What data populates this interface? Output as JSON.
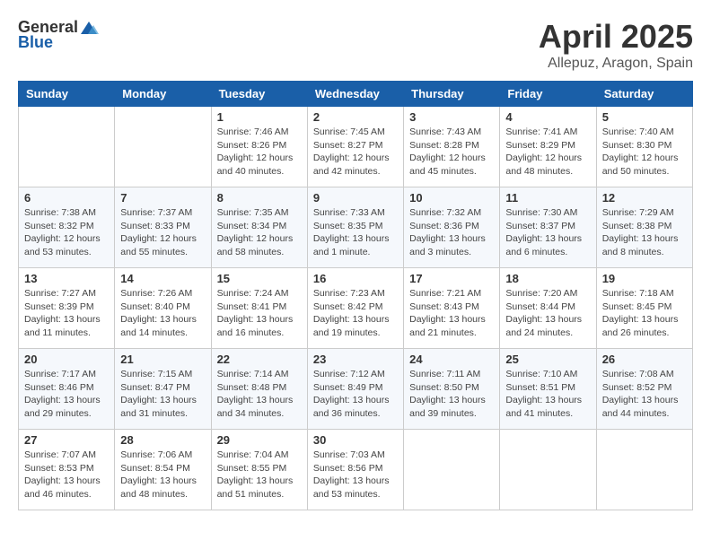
{
  "header": {
    "logo_general": "General",
    "logo_blue": "Blue",
    "month_title": "April 2025",
    "location": "Allepuz, Aragon, Spain"
  },
  "calendar": {
    "days_of_week": [
      "Sunday",
      "Monday",
      "Tuesday",
      "Wednesday",
      "Thursday",
      "Friday",
      "Saturday"
    ],
    "weeks": [
      [
        {
          "day": "",
          "detail": ""
        },
        {
          "day": "",
          "detail": ""
        },
        {
          "day": "1",
          "detail": "Sunrise: 7:46 AM\nSunset: 8:26 PM\nDaylight: 12 hours and 40 minutes."
        },
        {
          "day": "2",
          "detail": "Sunrise: 7:45 AM\nSunset: 8:27 PM\nDaylight: 12 hours and 42 minutes."
        },
        {
          "day": "3",
          "detail": "Sunrise: 7:43 AM\nSunset: 8:28 PM\nDaylight: 12 hours and 45 minutes."
        },
        {
          "day": "4",
          "detail": "Sunrise: 7:41 AM\nSunset: 8:29 PM\nDaylight: 12 hours and 48 minutes."
        },
        {
          "day": "5",
          "detail": "Sunrise: 7:40 AM\nSunset: 8:30 PM\nDaylight: 12 hours and 50 minutes."
        }
      ],
      [
        {
          "day": "6",
          "detail": "Sunrise: 7:38 AM\nSunset: 8:32 PM\nDaylight: 12 hours and 53 minutes."
        },
        {
          "day": "7",
          "detail": "Sunrise: 7:37 AM\nSunset: 8:33 PM\nDaylight: 12 hours and 55 minutes."
        },
        {
          "day": "8",
          "detail": "Sunrise: 7:35 AM\nSunset: 8:34 PM\nDaylight: 12 hours and 58 minutes."
        },
        {
          "day": "9",
          "detail": "Sunrise: 7:33 AM\nSunset: 8:35 PM\nDaylight: 13 hours and 1 minute."
        },
        {
          "day": "10",
          "detail": "Sunrise: 7:32 AM\nSunset: 8:36 PM\nDaylight: 13 hours and 3 minutes."
        },
        {
          "day": "11",
          "detail": "Sunrise: 7:30 AM\nSunset: 8:37 PM\nDaylight: 13 hours and 6 minutes."
        },
        {
          "day": "12",
          "detail": "Sunrise: 7:29 AM\nSunset: 8:38 PM\nDaylight: 13 hours and 8 minutes."
        }
      ],
      [
        {
          "day": "13",
          "detail": "Sunrise: 7:27 AM\nSunset: 8:39 PM\nDaylight: 13 hours and 11 minutes."
        },
        {
          "day": "14",
          "detail": "Sunrise: 7:26 AM\nSunset: 8:40 PM\nDaylight: 13 hours and 14 minutes."
        },
        {
          "day": "15",
          "detail": "Sunrise: 7:24 AM\nSunset: 8:41 PM\nDaylight: 13 hours and 16 minutes."
        },
        {
          "day": "16",
          "detail": "Sunrise: 7:23 AM\nSunset: 8:42 PM\nDaylight: 13 hours and 19 minutes."
        },
        {
          "day": "17",
          "detail": "Sunrise: 7:21 AM\nSunset: 8:43 PM\nDaylight: 13 hours and 21 minutes."
        },
        {
          "day": "18",
          "detail": "Sunrise: 7:20 AM\nSunset: 8:44 PM\nDaylight: 13 hours and 24 minutes."
        },
        {
          "day": "19",
          "detail": "Sunrise: 7:18 AM\nSunset: 8:45 PM\nDaylight: 13 hours and 26 minutes."
        }
      ],
      [
        {
          "day": "20",
          "detail": "Sunrise: 7:17 AM\nSunset: 8:46 PM\nDaylight: 13 hours and 29 minutes."
        },
        {
          "day": "21",
          "detail": "Sunrise: 7:15 AM\nSunset: 8:47 PM\nDaylight: 13 hours and 31 minutes."
        },
        {
          "day": "22",
          "detail": "Sunrise: 7:14 AM\nSunset: 8:48 PM\nDaylight: 13 hours and 34 minutes."
        },
        {
          "day": "23",
          "detail": "Sunrise: 7:12 AM\nSunset: 8:49 PM\nDaylight: 13 hours and 36 minutes."
        },
        {
          "day": "24",
          "detail": "Sunrise: 7:11 AM\nSunset: 8:50 PM\nDaylight: 13 hours and 39 minutes."
        },
        {
          "day": "25",
          "detail": "Sunrise: 7:10 AM\nSunset: 8:51 PM\nDaylight: 13 hours and 41 minutes."
        },
        {
          "day": "26",
          "detail": "Sunrise: 7:08 AM\nSunset: 8:52 PM\nDaylight: 13 hours and 44 minutes."
        }
      ],
      [
        {
          "day": "27",
          "detail": "Sunrise: 7:07 AM\nSunset: 8:53 PM\nDaylight: 13 hours and 46 minutes."
        },
        {
          "day": "28",
          "detail": "Sunrise: 7:06 AM\nSunset: 8:54 PM\nDaylight: 13 hours and 48 minutes."
        },
        {
          "day": "29",
          "detail": "Sunrise: 7:04 AM\nSunset: 8:55 PM\nDaylight: 13 hours and 51 minutes."
        },
        {
          "day": "30",
          "detail": "Sunrise: 7:03 AM\nSunset: 8:56 PM\nDaylight: 13 hours and 53 minutes."
        },
        {
          "day": "",
          "detail": ""
        },
        {
          "day": "",
          "detail": ""
        },
        {
          "day": "",
          "detail": ""
        }
      ]
    ]
  }
}
